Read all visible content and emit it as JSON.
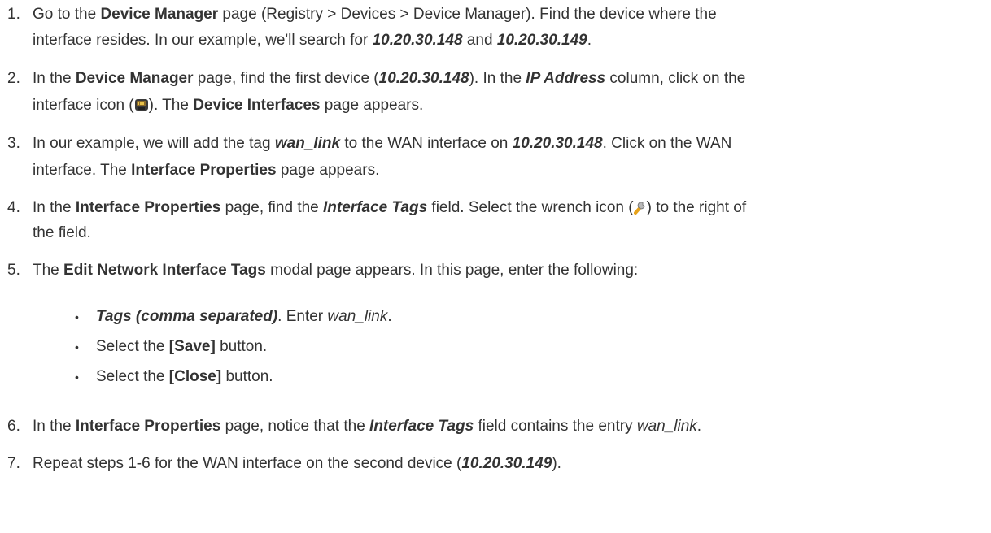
{
  "steps": [
    {
      "num": "1.",
      "t1": "Go to the ",
      "t2": "Device Manager",
      "t3": " page (Registry > Devices > Device Manager). Find the device where the",
      "t4": "interface resides. In our example, we'll search for ",
      "t5": "10.20.30.148",
      "t6": " and ",
      "t7": "10.20.30.149",
      "t8": "."
    },
    {
      "num": "2.",
      "t1": "In the ",
      "t2": "Device Manager",
      "t3": " page, find the first device (",
      "t4": "10.20.30.148",
      "t5": "). In the ",
      "t6": "IP Address",
      "t7": " column, click on the",
      "t8": "interface icon (",
      "t9": "). The ",
      "t10": "Device Interfaces",
      "t11": " page appears."
    },
    {
      "num": "3.",
      "t1": "In our example, we will add the tag ",
      "t2": "wan_link",
      "t3": " to the WAN interface on ",
      "t4": "10.20.30.148",
      "t5": ". Click on the WAN",
      "t6": "interface. The ",
      "t7": "Interface Properties",
      "t8": " page appears."
    },
    {
      "num": "4.",
      "t1": "In the ",
      "t2": "Interface Properties",
      "t3": " page, find the ",
      "t4": "Interface Tags",
      "t5": " field. Select the wrench icon (",
      "t6": ") to the right of",
      "t7": "the field."
    },
    {
      "num": "5.",
      "t1": "The ",
      "t2": "Edit Network Interface Tags",
      "t3": " modal page appears. In this page, enter the following:",
      "sub": [
        {
          "a": "Tags (comma separated)",
          "b": ". Enter ",
          "c": "wan_link",
          "d": "."
        },
        {
          "a": "Select the ",
          "b": "[Save]",
          "c": " button."
        },
        {
          "a": "Select the ",
          "b": "[Close]",
          "c": " button."
        }
      ]
    },
    {
      "num": "6.",
      "t1": "In the ",
      "t2": "Interface Properties",
      "t3": " page, notice that the ",
      "t4": "Interface Tags",
      "t5": " field contains the entry ",
      "t6": "wan_link",
      "t7": "."
    },
    {
      "num": "7.",
      "t1": "Repeat steps 1-6 for the WAN interface on the second device (",
      "t2": "10.20.30.149",
      "t3": ")."
    }
  ],
  "icons": {
    "interface": "network-interface-icon",
    "wrench": "wrench-icon"
  }
}
